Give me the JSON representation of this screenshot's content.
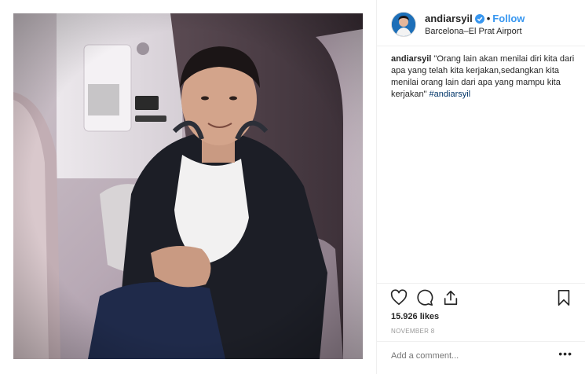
{
  "post": {
    "username": "andiarsyil",
    "verified": true,
    "follow_label": "Follow",
    "location": "Barcelona–El Prat Airport",
    "caption": {
      "username": "andiarsyil",
      "text": "\"Orang lain akan menilai diri kita dari apa yang telah kita kerjakan,sedangkan kita menilai orang lain dari apa yang mampu kita kerjakan\" ",
      "hashtag": "#andiarsyil"
    },
    "likes": "15.926 likes",
    "date": "NOVEMBER 8",
    "comment_placeholder": "Add a comment...",
    "more_label": "•••"
  },
  "icons": {
    "like": "heart-icon",
    "comment": "comment-icon",
    "share": "share-icon",
    "save": "bookmark-icon",
    "verified": "verified-badge-icon"
  },
  "colors": {
    "link": "#3897f0",
    "hashtag": "#003569",
    "muted": "#999999",
    "text": "#262626"
  }
}
